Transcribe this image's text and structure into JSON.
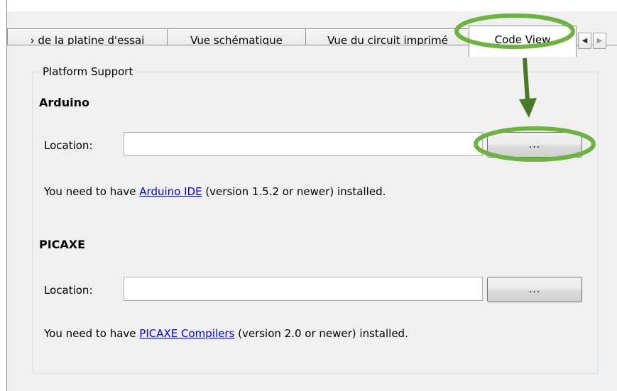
{
  "tabs": [
    {
      "label": "› de la platine d'essai"
    },
    {
      "label": "Vue schématique"
    },
    {
      "label": "Vue du circuit imprimé"
    },
    {
      "label": "Code View",
      "active": true
    }
  ],
  "tab_scroll": {
    "left_icon": "triangle-left-icon",
    "right_icon": "triangle-right-icon"
  },
  "group": {
    "title": "Platform Support"
  },
  "arduino": {
    "title": "Arduino",
    "location_label": "Location:",
    "location_value": "",
    "browse_label": "...",
    "info_prefix": "You need to have ",
    "link_text": "Arduino IDE",
    "info_suffix": " (version 1.5.2 or newer) installed."
  },
  "picaxe": {
    "title": "PICAXE",
    "location_label": "Location:",
    "location_value": "",
    "browse_label": "...",
    "info_prefix": "You need to have ",
    "link_text": "PICAXE Compilers",
    "info_suffix": " (version 2.0 or newer) installed."
  },
  "annotation": {
    "color": "#6db33f",
    "arrow_color": "#4a7a28"
  }
}
